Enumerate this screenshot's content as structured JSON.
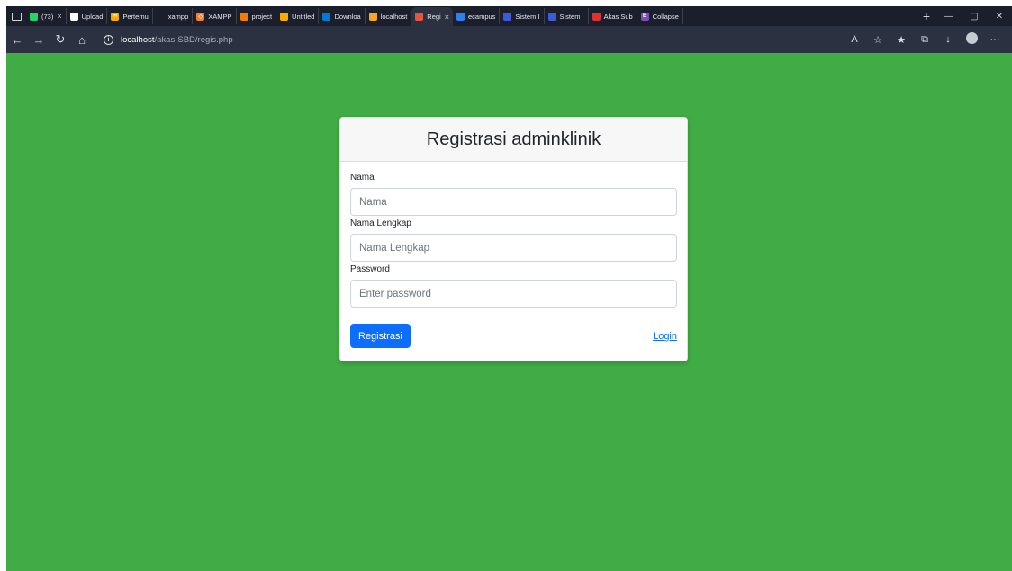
{
  "browser": {
    "tabs": [
      {
        "label": "(73)",
        "favicon_color": "#25d366",
        "favicon_glyph": "",
        "icon": "whatsapp-icon",
        "closable": true
      },
      {
        "label": "Upload",
        "favicon_color": "#ffffff",
        "favicon_glyph": "",
        "icon": "github-icon"
      },
      {
        "label": "Pertemu",
        "favicon_color": "#f9ab00",
        "favicon_glyph": "∞",
        "icon": "colab-icon"
      },
      {
        "label": "xampp",
        "favicon_color": "#1b1f2b",
        "favicon_glyph": "",
        "icon": "search-icon"
      },
      {
        "label": "XAMPP",
        "favicon_color": "#fb7a24",
        "favicon_glyph": "◇",
        "icon": "xampp-icon"
      },
      {
        "label": "project",
        "favicon_color": "#f57c00",
        "favicon_glyph": "",
        "icon": "jupyter-icon"
      },
      {
        "label": "Untitled",
        "favicon_color": "#f9ab00",
        "favicon_glyph": "",
        "icon": "notebook-icon"
      },
      {
        "label": "Downloa",
        "favicon_color": "#0078d4",
        "favicon_glyph": "",
        "icon": "download-icon"
      },
      {
        "label": "localhost",
        "favicon_color": "#f5a623",
        "favicon_glyph": "",
        "icon": "phpmyadmin-icon"
      },
      {
        "label": "Regi",
        "favicon_color": "#e8553f",
        "favicon_glyph": "",
        "icon": "xampp-icon",
        "active": true,
        "closable": true
      },
      {
        "label": "ecampus",
        "favicon_color": "#2f80ed",
        "favicon_glyph": "",
        "icon": "globe-icon"
      },
      {
        "label": "Sistem I",
        "favicon_color": "#3b5bdb",
        "favicon_glyph": "",
        "icon": "document-icon"
      },
      {
        "label": "Sistem I",
        "favicon_color": "#3b5bdb",
        "favicon_glyph": "",
        "icon": "document-icon"
      },
      {
        "label": "Akas Sub",
        "favicon_color": "#e03131",
        "favicon_glyph": "",
        "icon": "pdf-icon"
      },
      {
        "label": "Collapse",
        "favicon_color": "#7952b3",
        "favicon_glyph": "B",
        "icon": "bootstrap-icon"
      }
    ],
    "url_host": "localhost",
    "url_path": "/akas-SBD/regis.php"
  },
  "form": {
    "title": "Registrasi adminklinik",
    "fields": [
      {
        "label": "Nama",
        "placeholder": "Nama",
        "value": ""
      },
      {
        "label": "Nama Lengkap",
        "placeholder": "Nama Lengkap",
        "value": ""
      },
      {
        "label": "Password",
        "placeholder": "Enter password",
        "value": ""
      }
    ],
    "submit_label": "Registrasi",
    "login_link_label": "Login"
  },
  "colors": {
    "page_background": "#41ac45",
    "primary": "#0d6efd"
  }
}
